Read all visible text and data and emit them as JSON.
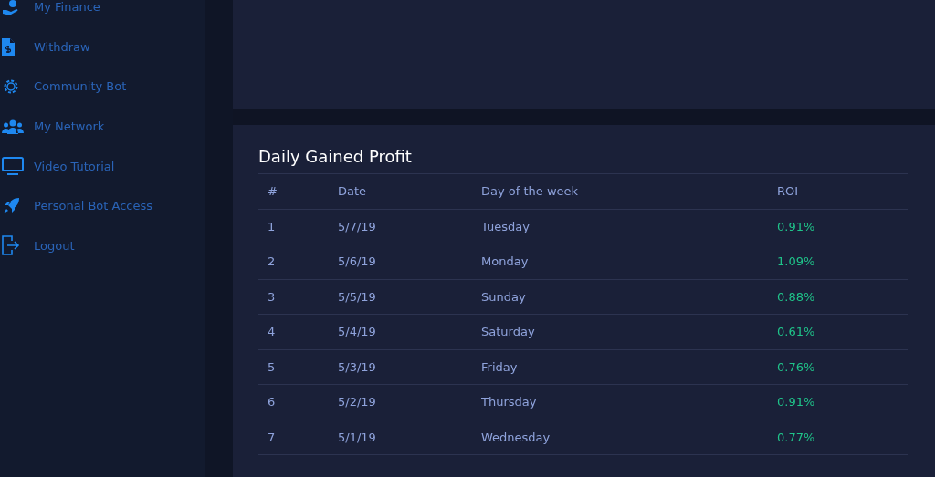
{
  "sidebar": {
    "items": [
      {
        "label": "My Finance"
      },
      {
        "label": "Withdraw"
      },
      {
        "label": "Community Bot"
      },
      {
        "label": "My Network"
      },
      {
        "label": "Video Tutorial"
      },
      {
        "label": "Personal Bot Access"
      },
      {
        "label": "Logout"
      }
    ]
  },
  "profit_table": {
    "title": "Daily Gained Profit",
    "columns": [
      "#",
      "Date",
      "Day of the week",
      "ROI"
    ],
    "rows": [
      [
        "1",
        "5/7/19",
        "Tuesday",
        "0.91%"
      ],
      [
        "2",
        "5/6/19",
        "Monday",
        "1.09%"
      ],
      [
        "3",
        "5/5/19",
        "Sunday",
        "0.88%"
      ],
      [
        "4",
        "5/4/19",
        "Saturday",
        "0.61%"
      ],
      [
        "5",
        "5/3/19",
        "Friday",
        "0.76%"
      ],
      [
        "6",
        "5/2/19",
        "Thursday",
        "0.91%"
      ],
      [
        "7",
        "5/1/19",
        "Wednesday",
        "0.77%"
      ]
    ]
  }
}
